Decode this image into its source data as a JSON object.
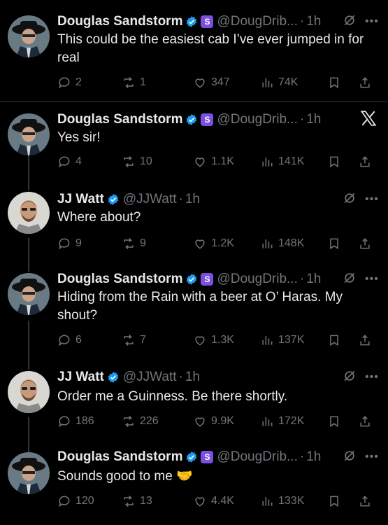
{
  "tweets": [
    {
      "author": "Douglas Sandstorm",
      "handle": "@DougDrib...",
      "time": "1h",
      "sub_badge": "S",
      "text": "This could be the easiest cab I’ve ever jumped in for real",
      "replies": "2",
      "reposts": "1",
      "likes": "347",
      "views": "74K"
    },
    {
      "author": "Douglas Sandstorm",
      "handle": "@DougDrib...",
      "time": "1h",
      "sub_badge": "S",
      "text": "Yes sir!",
      "replies": "4",
      "reposts": "10",
      "likes": "1.1K",
      "views": "141K"
    },
    {
      "author": "JJ Watt",
      "handle": "@JJWatt",
      "time": "1h",
      "text": "Where about?",
      "replies": "9",
      "reposts": "9",
      "likes": "1.2K",
      "views": "148K"
    },
    {
      "author": "Douglas Sandstorm",
      "handle": "@DougDrib...",
      "time": "1h",
      "sub_badge": "S",
      "text": "Hiding from the Rain with a beer at O’ Haras. My shout?",
      "replies": "6",
      "reposts": "7",
      "likes": "1.3K",
      "views": "137K"
    },
    {
      "author": "JJ Watt",
      "handle": "@JJWatt",
      "time": "1h",
      "text": "Order me a Guinness. Be there shortly.",
      "replies": "186",
      "reposts": "226",
      "likes": "9.9K",
      "views": "172K"
    },
    {
      "author": "Douglas Sandstorm",
      "handle": "@DougDrib...",
      "time": "1h",
      "sub_badge": "S",
      "text": "Sounds good to me 🤝",
      "replies": "120",
      "reposts": "13",
      "likes": "4.4K",
      "views": "133K"
    }
  ],
  "colors": {
    "background": "#000000",
    "text": "#e7e9ea",
    "muted": "#71767b",
    "verified": "#1d9bf0",
    "sub_badge": "#7b4fe0",
    "separator": "#2f3336"
  },
  "icons": {
    "reply": "reply-icon",
    "repost": "repost-icon",
    "like": "heart-icon",
    "views": "views-icon",
    "bookmark": "bookmark-icon",
    "share": "share-icon",
    "grok": "grok-icon",
    "more": "more-icon",
    "x": "x-logo-icon"
  }
}
